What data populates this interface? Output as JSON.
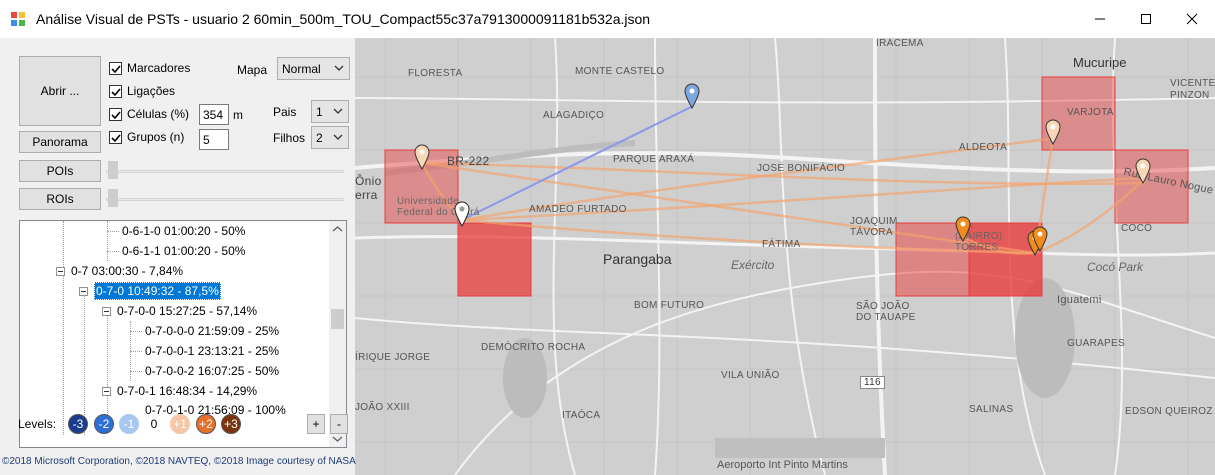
{
  "window": {
    "title": "Análise Visual de PSTs - usuario 2 60min_500m_TOU_Compact55c37a7913000091181b532a.json"
  },
  "panel": {
    "open_button": "Abrir ...",
    "panorama_button": "Panorama",
    "pois_button": "POIs",
    "rois_button": "ROIs",
    "checkboxes": [
      {
        "label": "Marcadores",
        "checked": true
      },
      {
        "label": "Ligações",
        "checked": true
      },
      {
        "label": "Células (%)",
        "checked": true
      },
      {
        "label": "Grupos (n)",
        "checked": true
      }
    ],
    "cells_value": "354",
    "cells_unit": "m",
    "groups_value": "5",
    "map_label": "Mapa",
    "map_mode": "Normal",
    "pais_label": "Pais",
    "pais_value": "1",
    "filhos_label": "Filhos",
    "filhos_value": "2"
  },
  "tree": {
    "nodes": [
      {
        "text": "0-6-1-0 01:00:20 - 50%"
      },
      {
        "text": "0-6-1-1 01:00:20 - 50%"
      },
      {
        "text": "0-7 03:00:30 - 7,84%"
      },
      {
        "text": "0-7-0 10:49:32 - 87,5%"
      },
      {
        "text": "0-7-0-0 15:27:25 - 57,14%"
      },
      {
        "text": "0-7-0-0-0 21:59:09 - 25%"
      },
      {
        "text": "0-7-0-0-1 23:13:21 - 25%"
      },
      {
        "text": "0-7-0-0-2 16:07:25 - 50%"
      },
      {
        "text": "0-7-0-1 16:48:34 - 14,29%"
      },
      {
        "text": "0-7-0-1-0 21:56:09 - 100%"
      }
    ]
  },
  "levels": {
    "label": "Levels:",
    "items": [
      "-3",
      "-2",
      "-1",
      "0",
      "+1",
      "+2",
      "+3"
    ],
    "colors": [
      "#1a3c8c",
      "#2e6fd6",
      "#a8c8f0",
      "#ffffff",
      "#f7c6a4",
      "#e8702a",
      "#7a3510"
    ],
    "plus": "+",
    "minus": "-"
  },
  "map": {
    "labels": [
      "IRACEMA",
      "FLORESTA",
      "MONTE CASTELO",
      "ALAGADIÇO",
      "PARQUE ARAXÁ",
      "JOSÉ BONIFÁCIO",
      "BR-222",
      "Universidade Federal do Ceará",
      "AMADEO FURTADO",
      "Parangaba",
      "Exército",
      "FÁTIMA",
      "JOAQUIM TÁVORA",
      "BOM FUTURO",
      "SÃO JOÃO DO TAUAPE",
      "DEMÓCRITO ROCHA",
      "VILA UNIÃO",
      "ITAÓCA",
      "Aeroporto Int Pinto Martins",
      "Mucuripe",
      "VARJOTA",
      "ALDEOTA",
      "VICENTE PINZON",
      "COCÓ",
      "Cocó Park",
      "Iguatemi",
      "GUARAPES",
      "SALINAS",
      "EDSON QUEIROZ",
      "JOÃO XXIII",
      "ÍRIQUE JORGE",
      "Ônio erra",
      "Rua Lauro Nogue",
      "CIA (BAIRRO) TORRES",
      "116"
    ],
    "copyright": "©2018 Microsoft Corporation, ©2018 NAVTEQ, ©2018 Image courtesy of NASA",
    "colors": {
      "cell": "#e83c3c",
      "link_orange": "#f5a36a",
      "link_blue": "#8c96f0",
      "marker_blue": "#7fa8e0",
      "marker_orange": "#f08c1e"
    }
  }
}
